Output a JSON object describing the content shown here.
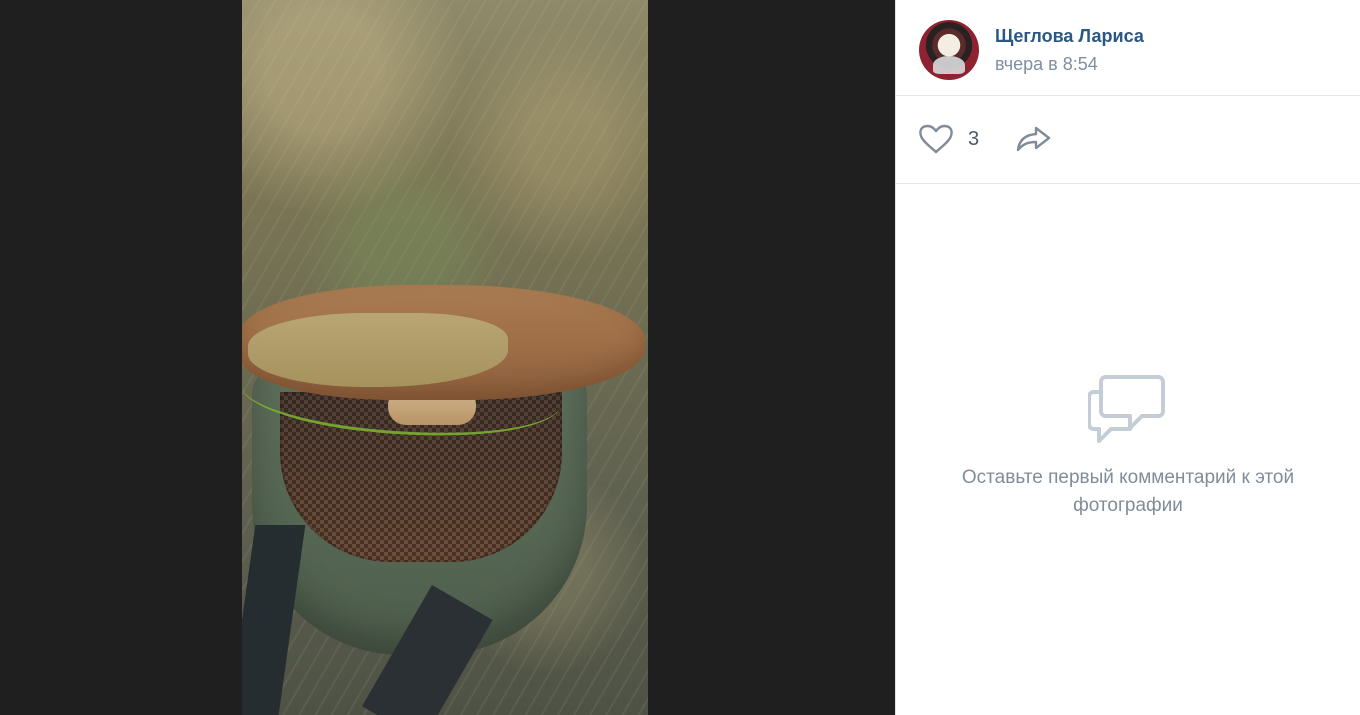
{
  "post": {
    "author_name": "Щеглова Лариса",
    "timestamp": "вчера в 8:54"
  },
  "actions": {
    "likes_count": "3",
    "like_icon": "heart-outline-icon",
    "share_icon": "share-arrow-icon"
  },
  "comments": {
    "empty_icon": "comments-bubble-icon",
    "empty_text": "Оставьте первый комментарий к этой фотографии"
  },
  "colors": {
    "link": "#2a5885",
    "muted": "#818c99",
    "divider": "#e7e8ec"
  }
}
